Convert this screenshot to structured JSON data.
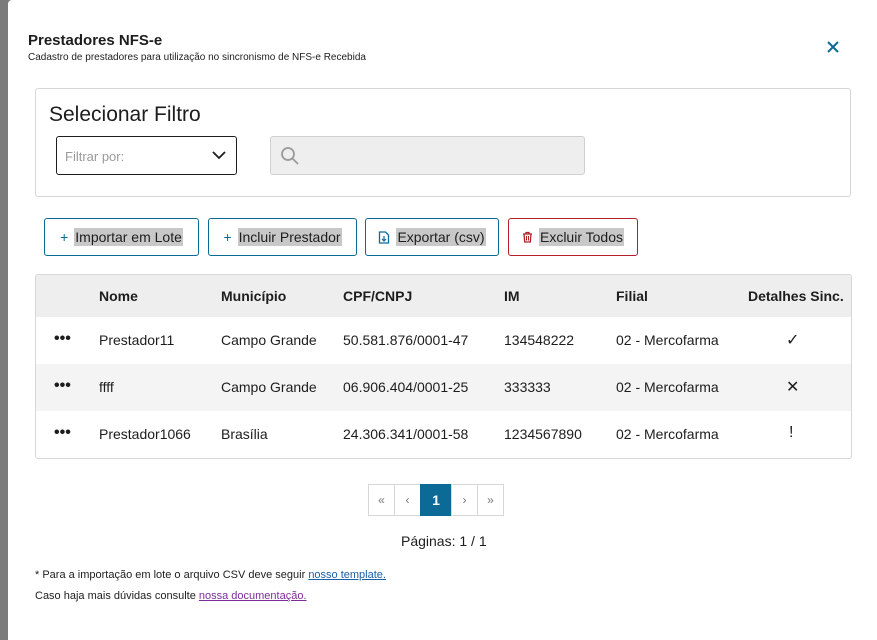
{
  "modal": {
    "title": "Prestadores NFS-e",
    "subtitle": "Cadastro de prestadores para utilização no sincronismo de NFS-e Recebida"
  },
  "filter": {
    "title": "Selecionar Filtro",
    "select_placeholder": "Filtrar por:",
    "search_value": ""
  },
  "actions": {
    "import_label": "Importar em Lote",
    "include_label": "Incluir Prestador",
    "export_label": "Exportar (csv)",
    "delete_all_label": "Excluir Todos"
  },
  "table": {
    "columns": [
      "Nome",
      "Município",
      "CPF/CNPJ",
      "IM",
      "Filial",
      "Detalhes Sinc."
    ],
    "rows": [
      {
        "nome": "Prestador11",
        "municipio": "Campo Grande",
        "cpf_cnpj": "50.581.876/0001-47",
        "im": "134548222",
        "filial": "02 - Mercofarma",
        "status": "✓"
      },
      {
        "nome": "ffff",
        "municipio": "Campo Grande",
        "cpf_cnpj": "06.906.404/0001-25",
        "im": "333333",
        "filial": "02 - Mercofarma",
        "status": "✕"
      },
      {
        "nome": "Prestador1066",
        "municipio": "Brasília",
        "cpf_cnpj": "24.306.341/0001-58",
        "im": "1234567890",
        "filial": "02 - Mercofarma",
        "status": "!"
      }
    ],
    "row_menu": "•••"
  },
  "pagination": {
    "first": "«",
    "prev": "‹",
    "current": "1",
    "next": "›",
    "last": "»",
    "summary": "Páginas: 1 / 1"
  },
  "footer": {
    "note1_text": "* Para a importação em lote o arquivo CSV deve seguir ",
    "note1_link": "nosso template.",
    "note2_text": "Caso haja mais dúvidas consulte ",
    "note2_link": "nossa documentação."
  },
  "colors": {
    "accent": "#0c6a97",
    "danger": "#b3202a"
  }
}
